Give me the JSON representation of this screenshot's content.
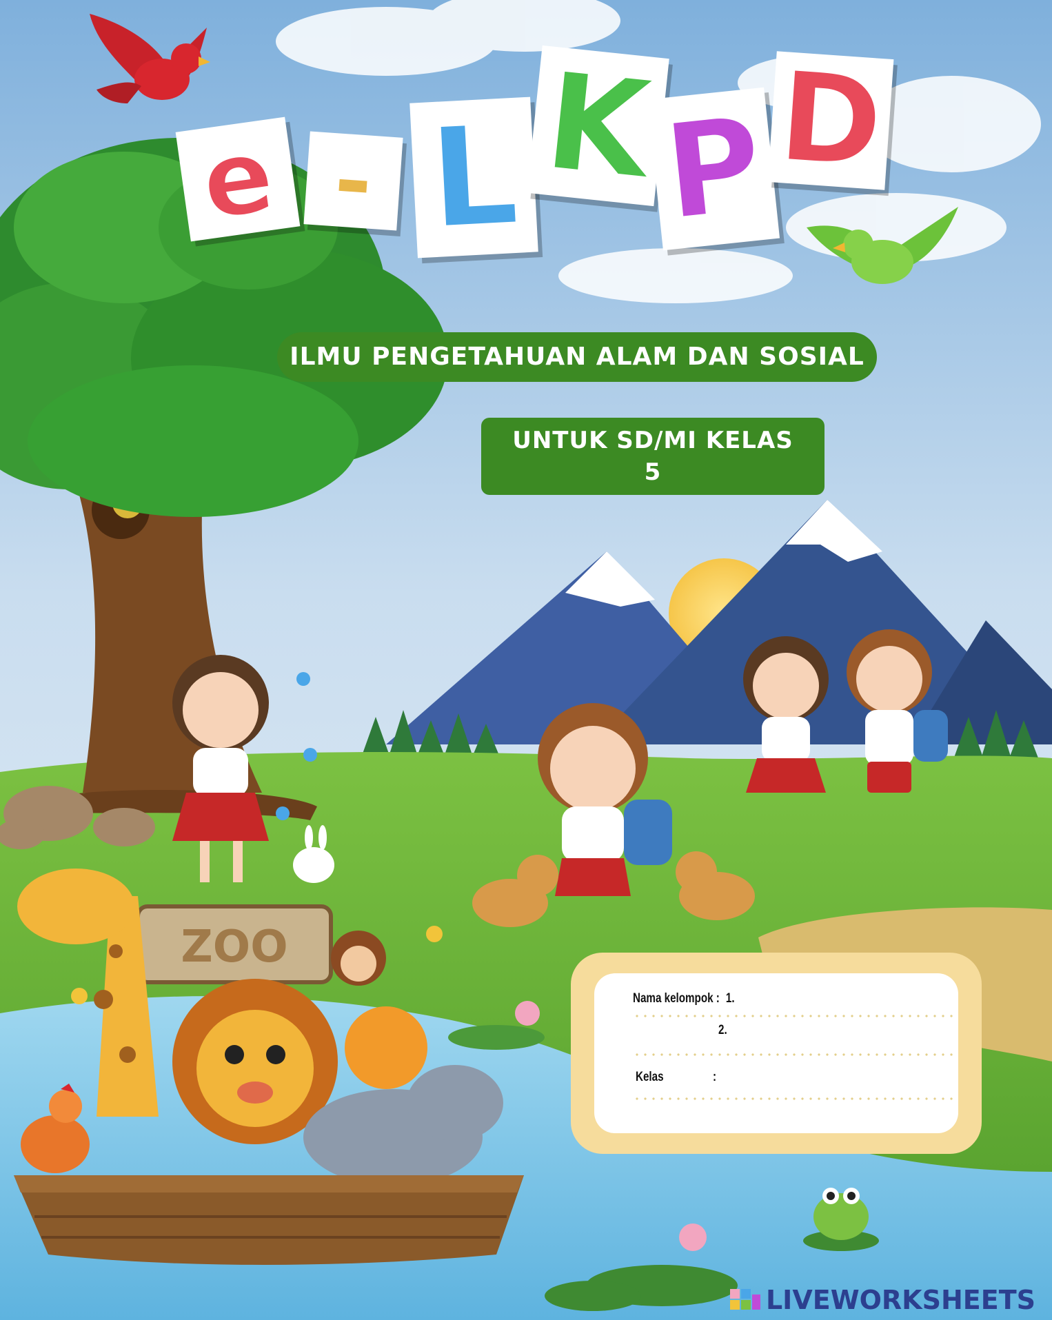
{
  "title": {
    "letters": [
      "e",
      "-",
      "L",
      "K",
      "P",
      "D"
    ],
    "letter_colors": [
      "#e84a5a",
      "#e8b64a",
      "#4aa6e8",
      "#4ac04a",
      "#c04ad8",
      "#e84a5a"
    ]
  },
  "subject_banner": "ILMU PENGETAHUAN ALAM DAN SOSIAL",
  "class_banner": {
    "line1": "UNTUK SD/MI KELAS",
    "line2": "5"
  },
  "form": {
    "group_label": "Nama kelompok :",
    "item1": "1.",
    "item2": "2.",
    "class_label": "Kelas",
    "class_colon": ":"
  },
  "zoo_sign": "ZOO",
  "watermark": "LIVEWORKSHEETS",
  "colors": {
    "banner_green": "#3c8a23",
    "card_border": "#f6dc9c",
    "sky": "#bcd6ec"
  }
}
